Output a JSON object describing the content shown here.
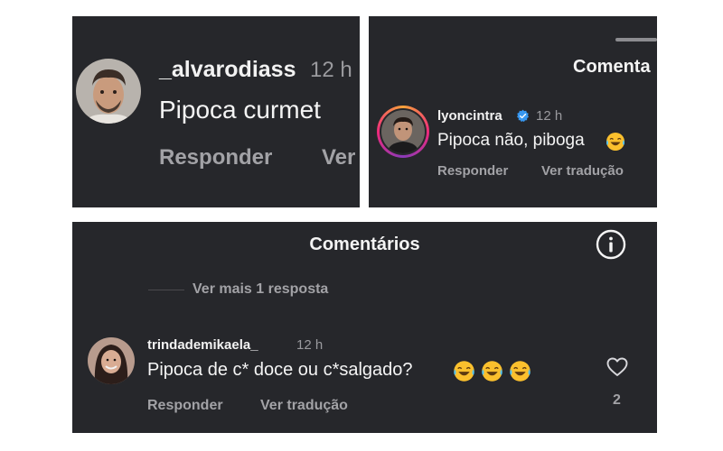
{
  "panel1": {
    "username": "_alvarodiass",
    "time": "12 h",
    "comment": "Pipoca curmet",
    "reply_label": "Responder",
    "translate_label": "Ver"
  },
  "panel2": {
    "header_title": "Comenta",
    "username": "lyoncintra",
    "time": "12 h",
    "comment": "Pipoca não, piboga",
    "reply_label": "Responder",
    "translate_label": "Ver tradução",
    "verified_icon": "verified-badge-icon",
    "emoji": "laughing-tears-emoji"
  },
  "panel3": {
    "header_title": "Comentários",
    "info_icon": "info-icon",
    "more_replies": "Ver mais 1 resposta",
    "username": "trindademikaela_",
    "time": "12 h",
    "comment": "Pipoca de c* doce ou c*salgado?",
    "reply_label": "Responder",
    "translate_label": "Ver tradução",
    "like_icon": "heart-outline-icon",
    "like_count": "2",
    "emoji_count": 3
  },
  "colors": {
    "panel_bg": "#26272b",
    "text_primary": "#f4f4f4",
    "text_secondary": "#a2a2a6",
    "verified": "#3797f0"
  }
}
